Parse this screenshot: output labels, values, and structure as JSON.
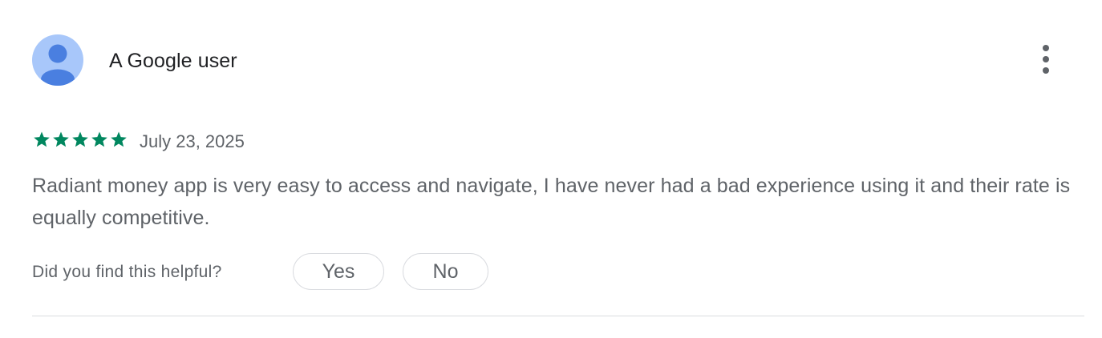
{
  "review": {
    "author": "A Google user",
    "avatar_icon": "person-icon",
    "menu_icon": "more-vert-icon",
    "rating": 5,
    "rating_max": 5,
    "date": "July 23, 2025",
    "text": "Radiant money app is very easy to access and navigate, I have never had a bad experience using it and their rate is equally competitive."
  },
  "helpful": {
    "question": "Did you find this helpful?",
    "yes_label": "Yes",
    "no_label": "No"
  },
  "colors": {
    "star": "#01875f",
    "avatar_bg": "#a8c7fa",
    "avatar_fg": "#4a7fe0",
    "text_secondary": "#5f6368",
    "border": "#dadce0"
  }
}
